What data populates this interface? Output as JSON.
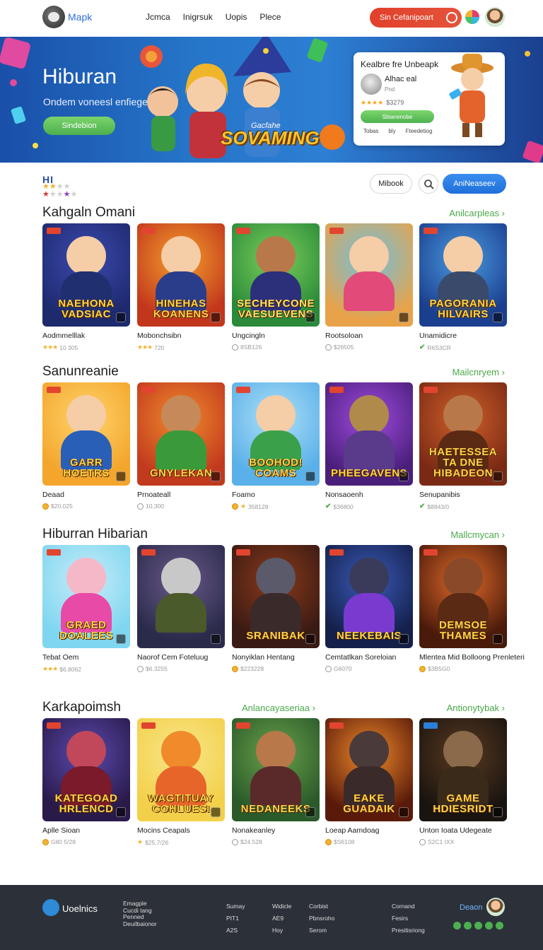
{
  "header": {
    "logo_text": "Mapk",
    "nav": [
      "Jcmca",
      "Inigrsuk",
      "Uopis",
      "Plece"
    ],
    "cta_label": "Sin Cefanipoart"
  },
  "hero": {
    "title": "Hiburan",
    "subtitle": "Ondem voneesl enfiegen",
    "button_label": "Sindebion",
    "game_title": "SOVAMING",
    "game_tag": "Gacfahe",
    "card": {
      "title": "Kealbre fre Unbeapk",
      "name": "Alhac eal",
      "meta": "Pnd",
      "rating_stars": "★★★★",
      "rating_value": "$3279",
      "button_label": "Sbianenobe",
      "links": [
        "Tobas",
        "bly",
        "Fteedetiog"
      ]
    }
  },
  "filter": {
    "label": "HI",
    "button_label": "Mibook",
    "action_label": "AniNeaseev"
  },
  "sections": [
    {
      "title": "Kahgaln Omani",
      "link": "Anilcarpleas",
      "cards": [
        {
          "title_art": "NAEHONA VADSIAC",
          "name": "Aodmmelllak",
          "meta_icon": "stars",
          "meta": "10 305"
        },
        {
          "title_art": "HINEHAS KOANENS",
          "name": "Mobonchsibn",
          "meta_icon": "stars",
          "meta": "720"
        },
        {
          "title_art": "SECHEYCONE VAESUEVENS",
          "name": "Ungcingln",
          "meta_icon": "circle",
          "meta": "8SB126"
        },
        {
          "title_art": "",
          "name": "Rootsoloan",
          "meta_icon": "circle",
          "meta": "$26505"
        },
        {
          "title_art": "PAGORANIA HILVAIRS",
          "name": "Unamidicre",
          "meta_icon": "check",
          "meta": "R6S3CR"
        }
      ]
    },
    {
      "title": "Sanunreanie",
      "link": "Mailcnryem",
      "cards": [
        {
          "title_art": "GARR HOETRS",
          "name": "Deaad",
          "meta_icon": "coin",
          "meta": "$20.025"
        },
        {
          "title_art": "GNYLEKAN",
          "name": "Prnoateall",
          "meta_icon": "circle",
          "meta": "10,300"
        },
        {
          "title_art": "BOOHOD! COAMS",
          "name": "Foamo",
          "meta_icon": "coin-star",
          "meta": "358128"
        },
        {
          "title_art": "PHEEGAVENS",
          "name": "Nonsaoenh",
          "meta_icon": "check",
          "meta": "$36800"
        },
        {
          "title_art": "HAETESSEA TA DNE HIBADEON",
          "name": "Senupanibis",
          "meta_icon": "check",
          "meta": "$8843/0"
        }
      ]
    },
    {
      "title": "Hiburran Hibarian",
      "link": "Mallcmycan",
      "cards": [
        {
          "title_art": "GRAED DOALEES",
          "name": "Tebat Oem",
          "meta_icon": "stars",
          "meta": "$6.8062"
        },
        {
          "title_art": "",
          "name": "Naorof Cem Foteluug",
          "meta_icon": "circle",
          "meta": "$6.3255"
        },
        {
          "title_art": "SRANIBAK",
          "name": "Nonyiklan Hentang",
          "meta_icon": "coin",
          "meta": "$223228"
        },
        {
          "title_art": "NEEKEBAIS",
          "name": "Cemtatlkan Soreloian",
          "meta_icon": "circle",
          "meta": "G6070"
        },
        {
          "title_art": "DEMSOE THAMES",
          "name": "Mlentea Mid Bolloong Prenleteri",
          "meta_icon": "coin",
          "meta": "$3B5G0"
        }
      ]
    },
    {
      "title": "Karkapoimsh",
      "link": "Antionytybak",
      "link_secondary": "Anlancayaseriaa",
      "cards": [
        {
          "title_art": "KATEGOAD HRLENCD",
          "name": "Aplle Sioan",
          "meta_icon": "coin",
          "meta": "G80 5/28"
        },
        {
          "title_art": "WAGTITUAY COHLUESI",
          "name": "Mocins Ceapals",
          "meta_icon": "star",
          "meta": "$25.7/26"
        },
        {
          "title_art": "NEDANEEKS",
          "name": "Nonakeanley",
          "meta_icon": "circle",
          "meta": "$24.528"
        },
        {
          "title_art": "EAKE GUADAIK",
          "name": "Loeap Aamdoag",
          "meta_icon": "coin",
          "meta": "$S6108"
        },
        {
          "title_art": "GAME HDIESRIDT",
          "name": "Unton Ioata Udegeate",
          "meta_icon": "circle",
          "meta": "S2C1 IXX"
        }
      ]
    }
  ],
  "footer": {
    "logo_text": "Uoelnics",
    "col1": [
      "Emagple",
      "Cucdi tang",
      "Penned",
      "Deuilbaionor"
    ],
    "col2": [
      "Sumay",
      "PIT1",
      "A2S"
    ],
    "col3": [
      "Widicle",
      "AE9",
      "Hoy"
    ],
    "col4": [
      "Corbist",
      "Pbnsroho",
      "Serom"
    ],
    "col5": [
      "Cornand",
      "Fesirs",
      "Presitisriong"
    ],
    "brand": "Deaon"
  }
}
